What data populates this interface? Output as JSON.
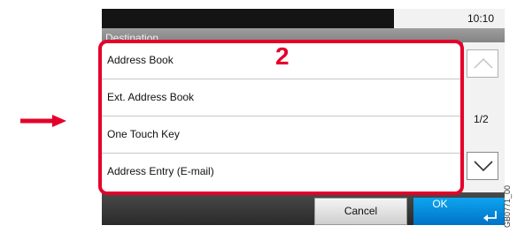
{
  "status_bar": {
    "time": "10:10"
  },
  "header": {
    "title": "Destination"
  },
  "list": {
    "items": [
      {
        "label": "Address Book"
      },
      {
        "label": "Ext. Address Book"
      },
      {
        "label": "One Touch Key"
      },
      {
        "label": "Address Entry (E-mail)"
      }
    ]
  },
  "scroll": {
    "page_indicator": "1/2"
  },
  "footer": {
    "cancel_label": "Cancel",
    "ok_label": "OK"
  },
  "annotation": {
    "step_number": "2",
    "figure_code": "GB0771_00"
  },
  "colors": {
    "highlight": "#e4002b",
    "ok_button": "#0086d6",
    "arrow": "#e4002b"
  }
}
